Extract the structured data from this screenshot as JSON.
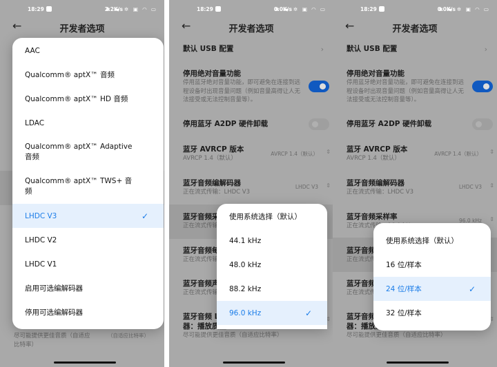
{
  "screens": [
    {
      "status": {
        "time": "18:29",
        "speed": "2.2K/s",
        "icons": "✱ ▬ ✲ ▣ ◠ ▭"
      },
      "header": {
        "title": "开发者选项"
      },
      "menu": {
        "items": [
          "AAC",
          "Qualcomm® aptX™ 音频",
          "Qualcomm® aptX™ HD 音频",
          "LDAC",
          "Qualcomm® aptX™ Adaptive 音频",
          "Qualcomm® aptX™ TWS+ 音频",
          "LHDC V3",
          "LHDC V2",
          "LHDC V1",
          "启用可选编解码器",
          "停用可选编解码器"
        ],
        "selected": "LHDC V3"
      },
      "bottom_row": {
        "desc": "尽可能提供更佳音质（自适应比特率）",
        "value": "（自适应比特率）"
      }
    },
    {
      "status": {
        "time": "18:29",
        "speed": "0.0K/s",
        "icons": "✱ ▬ ✲ ▣ ◠ ▭"
      },
      "header": {
        "title": "开发者选项"
      },
      "menu": {
        "items": [
          "使用系统选择（默认）",
          "44.1 kHz",
          "48.0 kHz",
          "88.2 kHz",
          "96.0 kHz"
        ],
        "selected": "96.0 kHz"
      }
    },
    {
      "status": {
        "time": "18:29",
        "speed": "0.0K/s",
        "icons": "✱ ▬ ✲ ▣ ◠ ▭"
      },
      "header": {
        "title": "开发者选项"
      },
      "menu": {
        "items": [
          "使用系统选择（默认）",
          "16 位/样本",
          "24 位/样本",
          "32 位/样本"
        ],
        "selected": "24 位/样本"
      }
    }
  ],
  "settings": {
    "usb": "默认 USB 配置",
    "abs_volume": {
      "title": "停用绝对音量功能",
      "desc": "停用蓝牙绝对音量功能，即可避免在连接到远程设备时出现音量问题（例如音量高得让人无法接受或无法控制音量等）。",
      "enabled": true
    },
    "a2dp": {
      "title": "停用蓝牙 A2DP 硬件卸载",
      "enabled": false
    },
    "avrcp": {
      "title": "蓝牙 AVRCP 版本",
      "desc": "AVRCP 1.4（默认）",
      "value": "AVRCP 1.4（默认）"
    },
    "codec": {
      "title": "蓝牙音频编解码器",
      "desc": "正在流式传输：LHDC V3",
      "value": "LHDC V3"
    },
    "sample_rate": {
      "title": "蓝牙音频采样率",
      "desc": "正在流式传输：96.0 kHz",
      "value": "96.0 kHz"
    },
    "bits": {
      "title": "蓝牙音频每个样本的位数",
      "desc": "正在流式传输：24 位/样本"
    },
    "channel": {
      "title": "蓝牙音频声道模式",
      "desc": "正在流式传输：立体声"
    },
    "ldac": {
      "title": "蓝牙音频 LDAC 编解码器：播放质量",
      "desc": "尽可能提供更佳音质（自适应比特率）",
      "value": "（自适应比特率）"
    }
  },
  "colors": {
    "accent": "#1a7ce8",
    "toggle_on": "#1059c0"
  }
}
